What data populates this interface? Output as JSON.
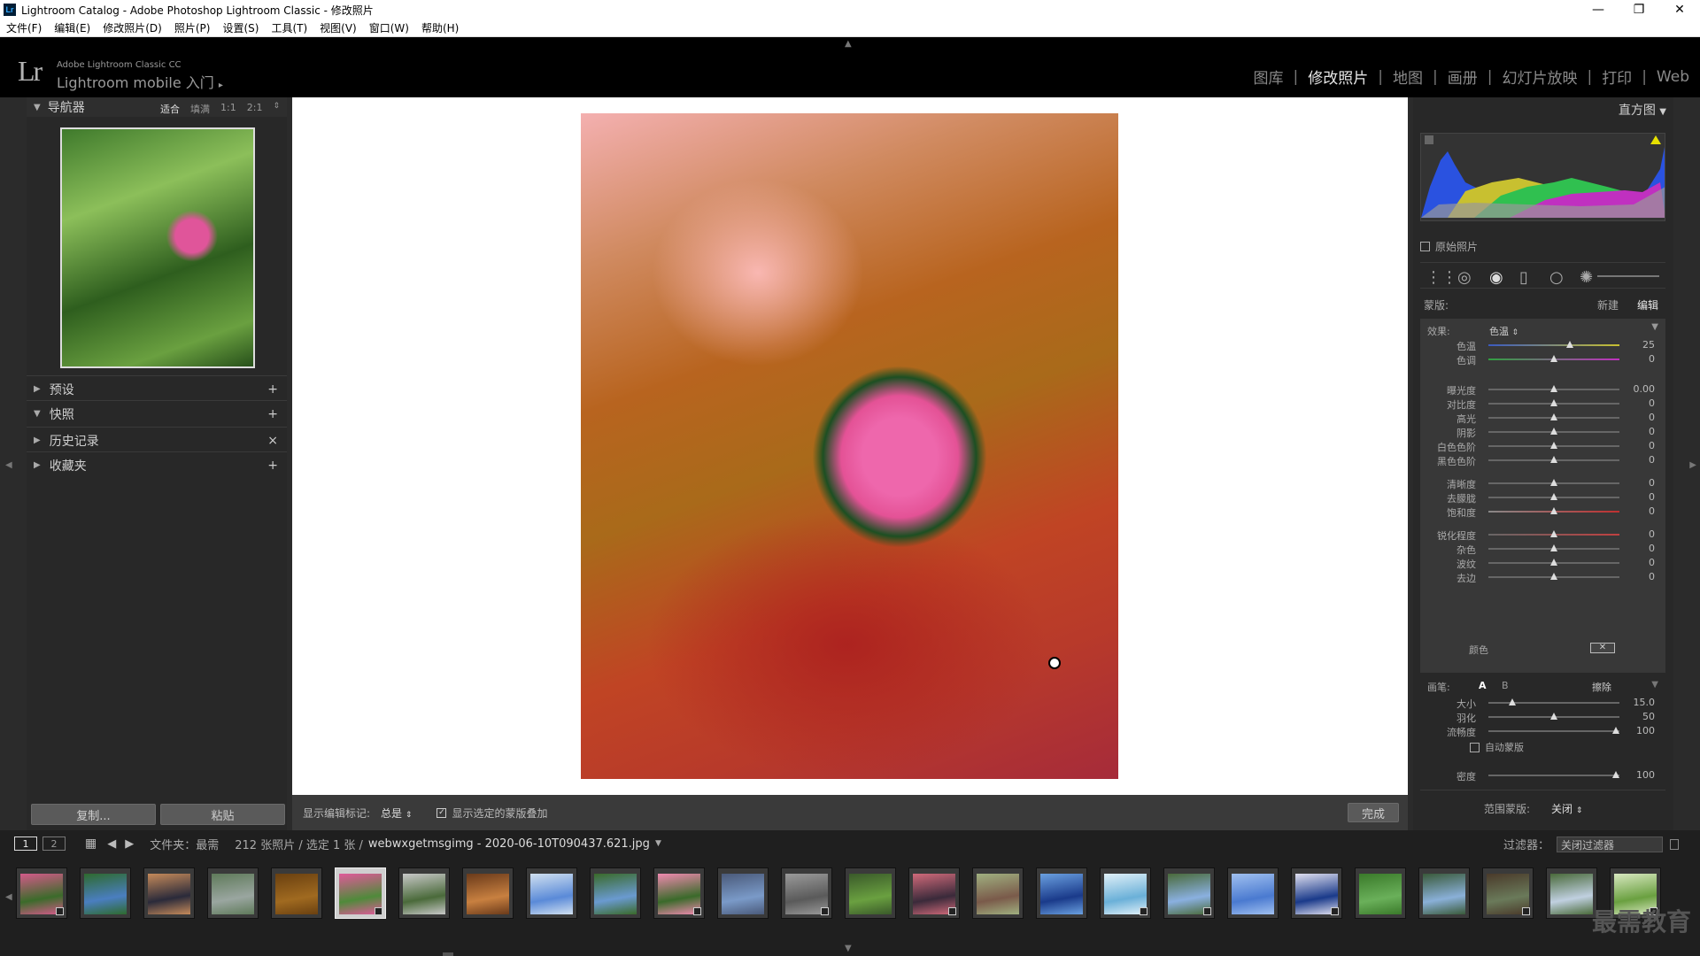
{
  "window": {
    "title": "Lightroom Catalog - Adobe Photoshop Lightroom Classic - 修改照片",
    "logo": "Lr"
  },
  "menu": [
    "文件(F)",
    "编辑(E)",
    "修改照片(D)",
    "照片(P)",
    "设置(S)",
    "工具(T)",
    "视图(V)",
    "窗口(W)",
    "帮助(H)"
  ],
  "identity": {
    "logo": "Lr",
    "product": "Adobe Lightroom Classic CC",
    "mobile": "Lightroom mobile 入门",
    "arrow": "▸"
  },
  "modules": [
    "图库",
    "修改照片",
    "地图",
    "画册",
    "幻灯片放映",
    "打印",
    "Web"
  ],
  "modules_active": 1,
  "left": {
    "navigator": {
      "title": "导航器",
      "opts": [
        "适合",
        "填满",
        "1:1",
        "2:1"
      ]
    },
    "sections": [
      {
        "label": "预设",
        "action": "+"
      },
      {
        "label": "快照",
        "action": "+"
      },
      {
        "label": "历史记录",
        "action": "×"
      },
      {
        "label": "收藏夹",
        "action": "+"
      }
    ],
    "copy": "复制...",
    "paste": "粘贴"
  },
  "toolbar": {
    "show_label": "显示编辑标记:",
    "show_value": "总是",
    "overlay_label": "显示选定的蒙版叠加",
    "done": "完成"
  },
  "right": {
    "histogram": "直方图",
    "original": "原始照片",
    "mask": {
      "label": "蒙版:",
      "new": "新建",
      "edit": "编辑"
    },
    "effect": {
      "label": "效果:",
      "value": "色温"
    },
    "sliders": [
      {
        "label": "色温",
        "value": "25",
        "pos": 0.62
      },
      {
        "label": "色调",
        "value": "0",
        "pos": 0.5
      },
      {
        "label": "曝光度",
        "value": "0.00",
        "pos": 0.5
      },
      {
        "label": "对比度",
        "value": "0",
        "pos": 0.5
      },
      {
        "label": "高光",
        "value": "0",
        "pos": 0.5
      },
      {
        "label": "阴影",
        "value": "0",
        "pos": 0.5
      },
      {
        "label": "白色色阶",
        "value": "0",
        "pos": 0.5
      },
      {
        "label": "黑色色阶",
        "value": "0",
        "pos": 0.5
      },
      {
        "label": "清晰度",
        "value": "0",
        "pos": 0.5
      },
      {
        "label": "去朦胧",
        "value": "0",
        "pos": 0.5
      },
      {
        "label": "饱和度",
        "value": "0",
        "pos": 0.5
      },
      {
        "label": "锐化程度",
        "value": "0",
        "pos": 0.5
      },
      {
        "label": "杂色",
        "value": "0",
        "pos": 0.5
      },
      {
        "label": "波纹",
        "value": "0",
        "pos": 0.5
      },
      {
        "label": "去边",
        "value": "0",
        "pos": 0.5
      }
    ],
    "color_label": "颜色",
    "brush": {
      "label": "画笔:",
      "a": "A",
      "b": "B",
      "erase": "擦除",
      "rows": [
        {
          "label": "大小",
          "value": "15.0",
          "pos": 0.18
        },
        {
          "label": "羽化",
          "value": "50",
          "pos": 0.5
        },
        {
          "label": "流畅度",
          "value": "100",
          "pos": 0.97
        }
      ],
      "auto": "自动蒙版",
      "density": {
        "label": "密度",
        "value": "100",
        "pos": 0.97
      }
    },
    "range": {
      "label": "范围蒙版:",
      "value": "关闭"
    }
  },
  "filmbar": {
    "pages": [
      "1",
      "2"
    ],
    "folder_label": "文件夹：最需",
    "count": "212 张照片 / 选定 1 张 /",
    "filename": "webwxgetmsgimg - 2020-06-10T090437.621.jpg",
    "filter_label": "过滤器：",
    "filter_value": "关闭过滤器"
  },
  "thumbs": [
    {
      "c1": "#3b6b2a",
      "c2": "#d45a8a",
      "badge": true
    },
    {
      "c1": "#4a7ec0",
      "c2": "#2e6a2e",
      "badge": false
    },
    {
      "c1": "#2a2a3a",
      "c2": "#c58a5a",
      "badge": false
    },
    {
      "c1": "#9aa6a0",
      "c2": "#5f7a5a",
      "badge": false
    },
    {
      "c1": "#a06a20",
      "c2": "#6a4010",
      "badge": false
    },
    {
      "c1": "#4f8a3a",
      "c2": "#e05a9a",
      "badge": true,
      "sel": true
    },
    {
      "c1": "#4a6a3a",
      "c2": "#c8c8c8",
      "badge": false
    },
    {
      "c1": "#c88040",
      "c2": "#6a3a1a",
      "badge": false
    },
    {
      "c1": "#5a8ad8",
      "c2": "#d0e0f0",
      "badge": false
    },
    {
      "c1": "#6a9ad0",
      "c2": "#3a6a2a",
      "badge": false
    },
    {
      "c1": "#3a6a2a",
      "c2": "#f08ab0",
      "badge": true
    },
    {
      "c1": "#7a9ac8",
      "c2": "#4a5a7a",
      "badge": false
    },
    {
      "c1": "#5a5a5a",
      "c2": "#9a9a9a",
      "badge": true
    },
    {
      "c1": "#6aa040",
      "c2": "#3a5a2a",
      "badge": false
    },
    {
      "c1": "#3a2a3a",
      "c2": "#d06a7a",
      "badge": true
    },
    {
      "c1": "#7a5a4a",
      "c2": "#a0b080",
      "badge": false
    },
    {
      "c1": "#1a3a8a",
      "c2": "#6aa0e0",
      "badge": false
    },
    {
      "c1": "#6ab0d8",
      "c2": "#e0f0f8",
      "badge": true
    },
    {
      "c1": "#8ab0e0",
      "c2": "#4a6a3a",
      "badge": true
    },
    {
      "c1": "#4a7ad0",
      "c2": "#a0c0f0",
      "badge": false
    },
    {
      "c1": "#1a3a8a",
      "c2": "#e0e0f0",
      "badge": true
    },
    {
      "c1": "#6ab05a",
      "c2": "#3a7a2a",
      "badge": false
    },
    {
      "c1": "#8ab0d8",
      "c2": "#3a5a3a",
      "badge": false
    },
    {
      "c1": "#6a7a5a",
      "c2": "#4a3a2a",
      "badge": true
    },
    {
      "c1": "#c0d0e0",
      "c2": "#4a6a3a",
      "badge": false
    },
    {
      "c1": "#6aa040",
      "c2": "#d8e8c0",
      "badge": true
    }
  ],
  "watermark": "最需教育"
}
